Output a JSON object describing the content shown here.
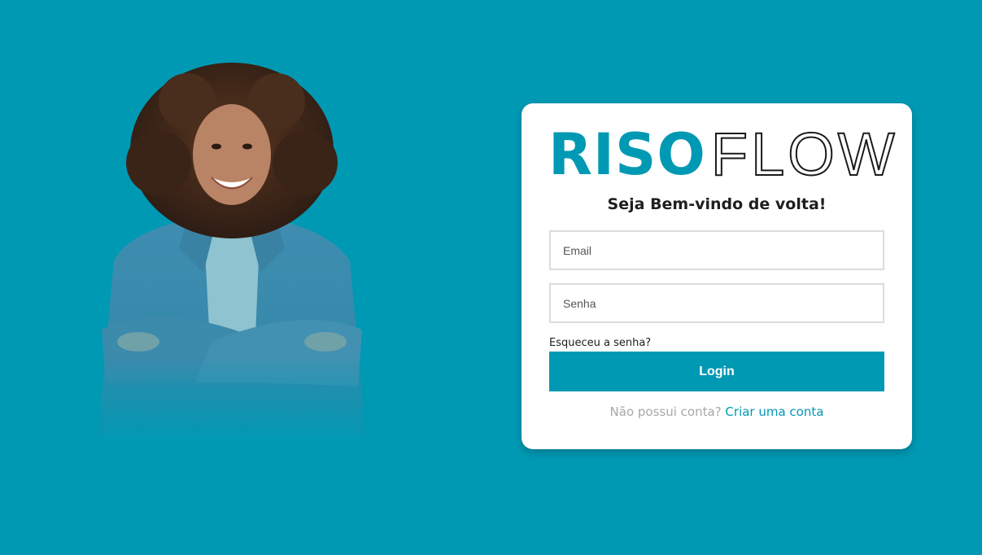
{
  "colors": {
    "background": "#0099b4",
    "accent": "#0099b4",
    "card": "#ffffff"
  },
  "hero": {
    "image": "smiling-woman-arms-crossed"
  },
  "login_card": {
    "logo": {
      "part1": "RISO",
      "part2": "FLOW"
    },
    "welcome_heading": "Seja Bem-vindo de volta!",
    "email": {
      "placeholder": "Email",
      "value": ""
    },
    "password": {
      "placeholder": "Senha",
      "value": ""
    },
    "forgot_password_link": "Esqueceu a senha?",
    "login_button": "Login",
    "signup_question": "Não possui conta?",
    "signup_link": "Criar uma conta"
  }
}
